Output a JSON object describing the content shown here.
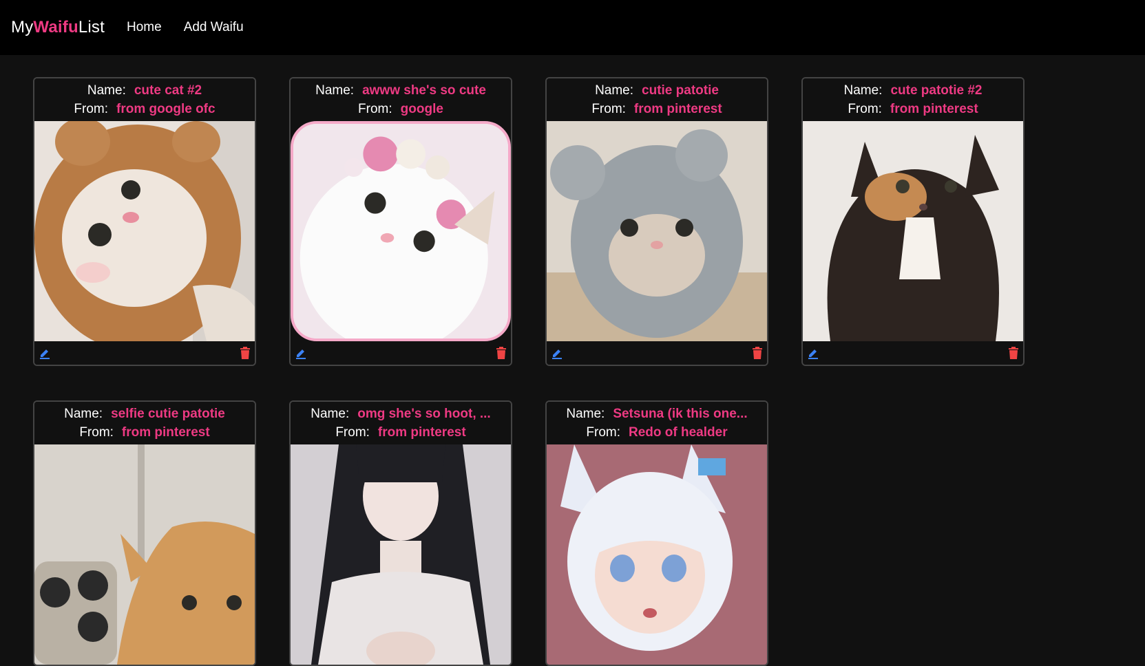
{
  "nav": {
    "brand_prefix": "My",
    "brand_accent": "Waifu",
    "brand_suffix": "List",
    "links": [
      "Home",
      "Add Waifu"
    ]
  },
  "labels": {
    "name": "Name:",
    "from": "From:"
  },
  "icons": {
    "edit": "pencil-icon",
    "delete": "trash-icon"
  },
  "colors": {
    "accent": "#ee3a83",
    "edit": "#3b82f6",
    "delete": "#ef4444"
  },
  "cards": [
    {
      "name": "cute cat #2",
      "from": "from google ofc"
    },
    {
      "name": "awww she's so cute",
      "from": "google"
    },
    {
      "name": "cutie patotie",
      "from": "from pinterest"
    },
    {
      "name": "cute patotie #2",
      "from": "from pinterest"
    },
    {
      "name": "selfie cutie patotie",
      "from": "from pinterest"
    },
    {
      "name": "omg she's so hoot, ...",
      "from": "from pinterest"
    },
    {
      "name": "Setsuna (ik this one...",
      "from": "Redo of healder"
    }
  ]
}
